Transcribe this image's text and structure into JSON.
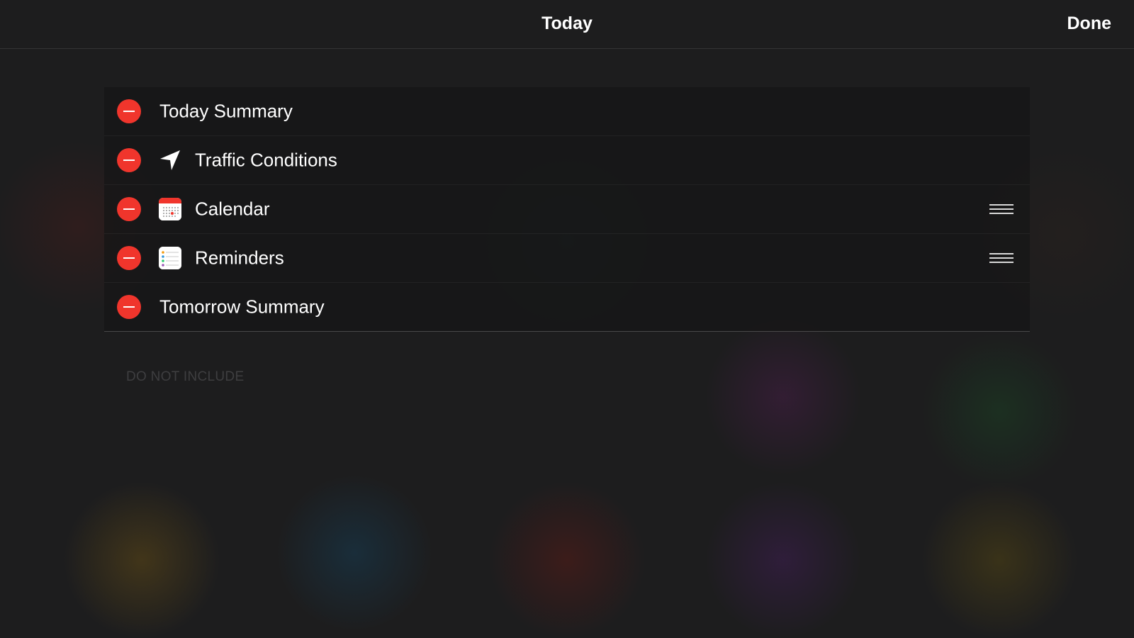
{
  "header": {
    "title": "Today",
    "done_label": "Done"
  },
  "widgets": [
    {
      "label": "Today Summary",
      "icon": null,
      "reorderable": false
    },
    {
      "label": "Traffic Conditions",
      "icon": "location-arrow-icon",
      "reorderable": false
    },
    {
      "label": "Calendar",
      "icon": "calendar-app-icon",
      "reorderable": true
    },
    {
      "label": "Reminders",
      "icon": "reminders-app-icon",
      "reorderable": true
    },
    {
      "label": "Tomorrow Summary",
      "icon": null,
      "reorderable": false
    }
  ],
  "sections": {
    "do_not_include_header": "DO NOT INCLUDE"
  },
  "colors": {
    "remove_button": "#f0352c",
    "background": "#1d1d1e",
    "text": "#ffffff",
    "section_header": "#3e3e40"
  }
}
